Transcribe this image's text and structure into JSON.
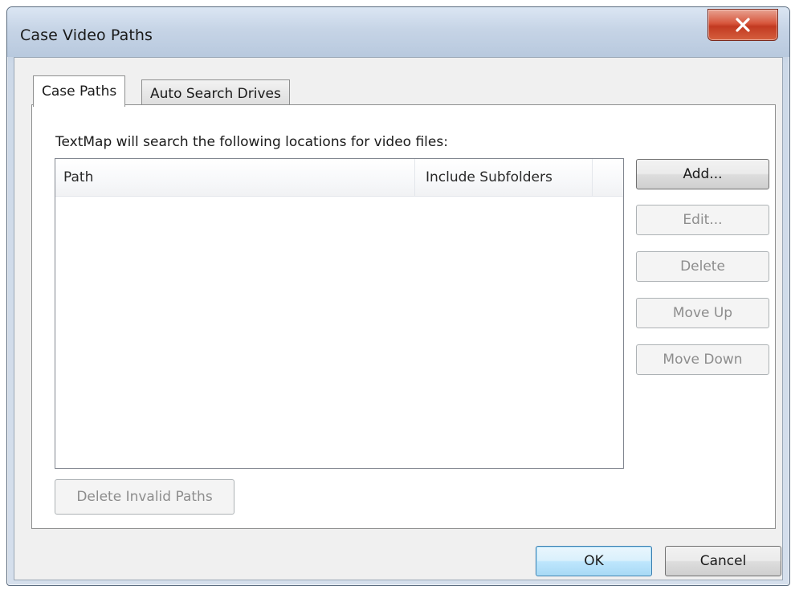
{
  "window": {
    "title": "Case Video Paths"
  },
  "tabs": [
    {
      "label": "Case Paths",
      "active": true
    },
    {
      "label": "Auto Search Drives",
      "active": false
    }
  ],
  "panel": {
    "description": "TextMap will search the following locations for video files:",
    "list": {
      "columns": [
        "Path",
        "Include Subfolders"
      ],
      "rows": []
    }
  },
  "buttons": {
    "add": "Add...",
    "edit": "Edit...",
    "delete": "Delete",
    "move_up": "Move Up",
    "move_down": "Move Down",
    "delete_invalid": "Delete Invalid Paths",
    "ok": "OK",
    "cancel": "Cancel"
  },
  "colors": {
    "close_button": "#c23a21",
    "default_button_border": "#3c7fb1",
    "disabled_text": "#8d8d8d"
  }
}
